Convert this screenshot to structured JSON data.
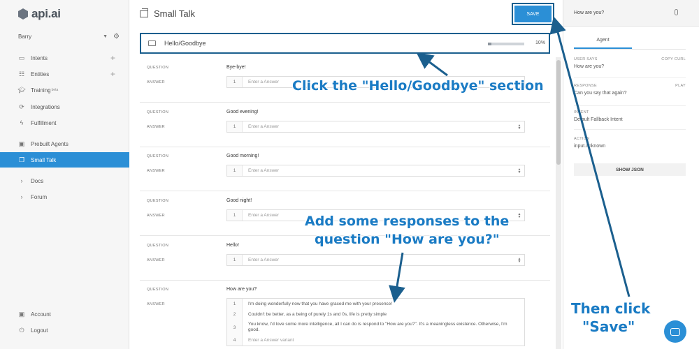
{
  "app": {
    "logo_text": "api.ai",
    "agent_name": "Barry"
  },
  "sidebar": {
    "items": [
      {
        "label": "Intents",
        "icon": "chat-icon",
        "plus": "+"
      },
      {
        "label": "Entities",
        "icon": "entities-icon",
        "plus": "+"
      },
      {
        "label": "Training",
        "icon": "training-icon",
        "badge": "beta"
      },
      {
        "label": "Integrations",
        "icon": "integrations-icon"
      },
      {
        "label": "Fulfillment",
        "icon": "bolt-icon"
      },
      {
        "label": "Prebuilt Agents",
        "icon": "prebuilt-icon"
      },
      {
        "label": "Small Talk",
        "icon": "small-talk-icon",
        "active": true
      },
      {
        "label": "Docs",
        "icon": "chevron-right-icon"
      },
      {
        "label": "Forum",
        "icon": "chevron-right-icon"
      }
    ],
    "footer": [
      {
        "label": "Account",
        "icon": "account-icon"
      },
      {
        "label": "Logout",
        "icon": "power-icon"
      }
    ]
  },
  "header": {
    "title": "Small Talk",
    "save_label": "SAVE"
  },
  "section": {
    "title": "Hello/Goodbye",
    "progress_text": "10%",
    "progress_fraction": 0.1
  },
  "labels": {
    "question": "QUESTION",
    "answer": "ANSWER"
  },
  "qa": [
    {
      "question": "Bye-bye!",
      "answers": [
        {
          "num": "1",
          "text": "Enter a Answer",
          "placeholder": true
        }
      ]
    },
    {
      "question": "Good evening!",
      "answers": [
        {
          "num": "1",
          "text": "Enter a Answer",
          "placeholder": true
        }
      ]
    },
    {
      "question": "Good morning!",
      "answers": [
        {
          "num": "1",
          "text": "Enter a Answer",
          "placeholder": true
        }
      ]
    },
    {
      "question": "Good night!",
      "answers": [
        {
          "num": "1",
          "text": "Enter a Answer",
          "placeholder": true
        }
      ]
    },
    {
      "question": "Hello!",
      "answers": [
        {
          "num": "1",
          "text": "Enter a Answer",
          "placeholder": true
        }
      ]
    },
    {
      "question": "How are you?",
      "answers": [
        {
          "num": "1",
          "text": "I'm doing wonderfully now that you have graced me with your presence!"
        },
        {
          "num": "2",
          "text": "Couldn't be better, as a being of purely 1s and 0s, life is pretty simple"
        },
        {
          "num": "3",
          "text": "You know, I'd love some more intelligence, all I can do is respond to \"How are you?\". It's a meaningless existence. Otherwise, I'm good."
        },
        {
          "num": "4",
          "text": "Enter a Answer variant",
          "placeholder": true
        }
      ]
    }
  ],
  "right_panel": {
    "query": "How are you?",
    "tab": "Agent",
    "user_says_label": "USER SAYS",
    "copy_curl": "COPY CURL",
    "user_says": "How are you?",
    "response_label": "RESPONSE",
    "play": "PLAY",
    "response": "Can you say that again?",
    "intent_label": "INTENT",
    "intent": "Default Fallback Intent",
    "action_label": "ACTION",
    "action": "input.unknown",
    "show_json": "SHOW JSON"
  },
  "annotations": {
    "click_section": "Click the \"Hello/Goodbye\" section",
    "add_responses_1": "Add some responses to the",
    "add_responses_2": "question \"How are you?\"",
    "then_click_1": "Then click",
    "then_click_2": "\"Save\""
  },
  "colors": {
    "accent": "#2b8fd6",
    "annotation": "#1a7bc4",
    "arrow": "#1b5f8e"
  }
}
